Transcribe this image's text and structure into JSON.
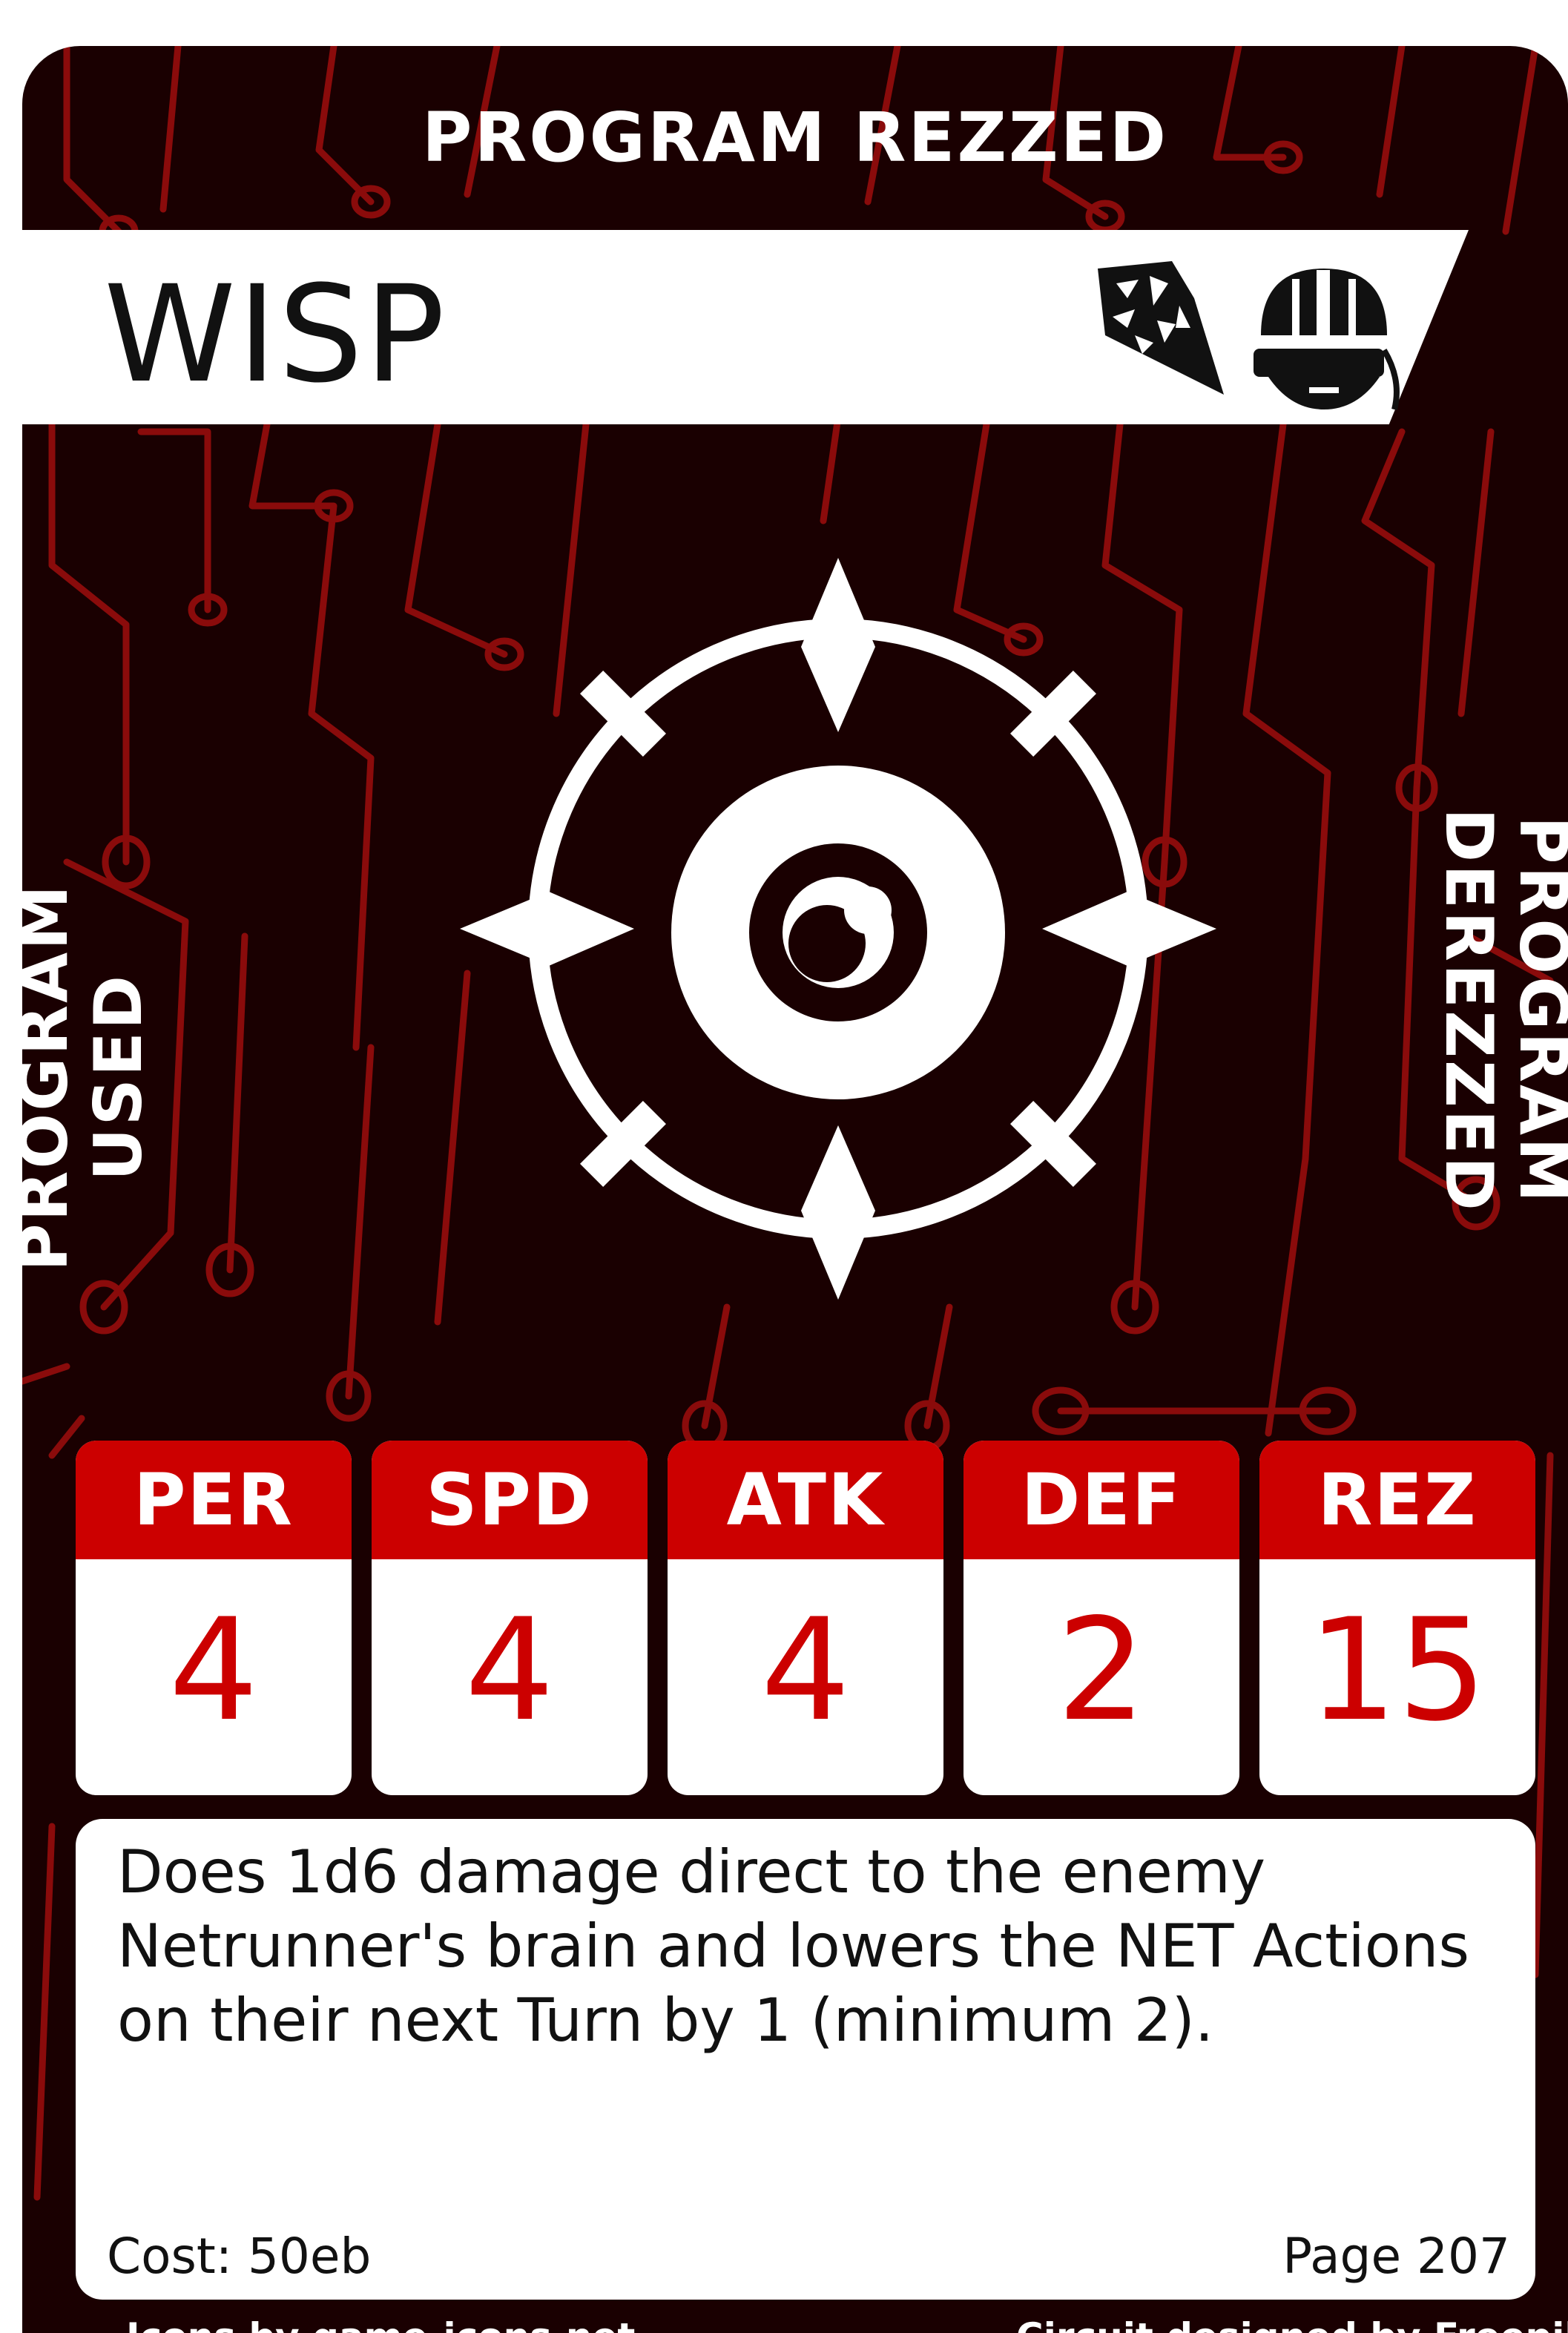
{
  "card": {
    "top_label": "PROGRAM REZZED",
    "name": "WISP",
    "left_label": "PROGRAM USED",
    "right_label": "PROGRAM DEREZZED",
    "banner_icons": [
      "shattered-crystal-icon",
      "vr-headset-icon"
    ],
    "emblem_icon": "compass-eye-icon",
    "stats": [
      {
        "label": "PER",
        "value": "4"
      },
      {
        "label": "SPD",
        "value": "4"
      },
      {
        "label": "ATK",
        "value": "4"
      },
      {
        "label": "DEF",
        "value": "2"
      },
      {
        "label": "REZ",
        "value": "15"
      }
    ],
    "description": "Does 1d6 damage direct to the enemy Netrunner's brain and lowers the NET Actions on their next Turn by 1 (minimum 2).",
    "cost": "Cost: 50eb",
    "page": "Page 207",
    "credit_left": "Icons by game-icons.net",
    "credit_right": "Circuit designed by Freepik"
  },
  "colors": {
    "background": "#1a0001",
    "circuit": "#8a0b0b",
    "accent_red": "#cc0000",
    "text_light": "#ffffff",
    "text_dark": "#111111"
  }
}
